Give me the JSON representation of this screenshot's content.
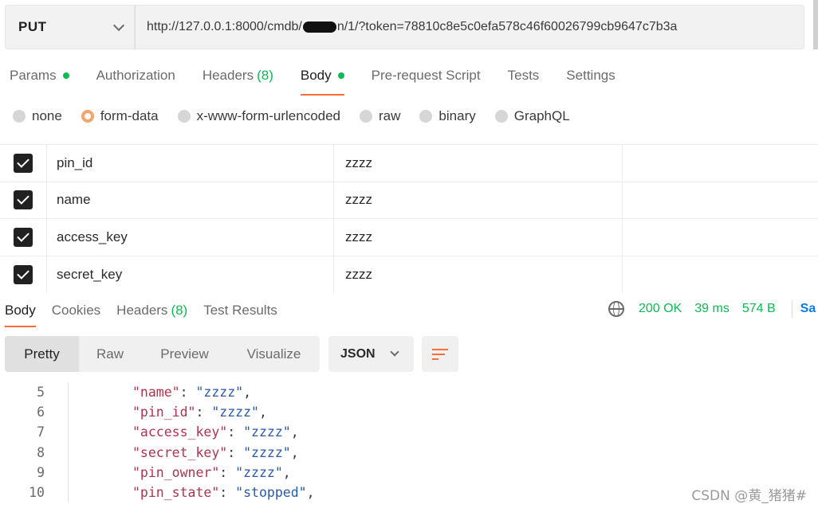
{
  "request": {
    "method": "PUT",
    "url_prefix": "http://127.0.0.1:8000/cmdb/",
    "url_mid": "",
    "url_suffix": "n/1/?token=78810c8e5c0efa578c46f60026799cb9647c7b3a"
  },
  "request_tabs": [
    {
      "label": "Params",
      "dot": true
    },
    {
      "label": "Authorization"
    },
    {
      "label": "Headers",
      "count": "(8)"
    },
    {
      "label": "Body",
      "dot": true,
      "active": true
    },
    {
      "label": "Pre-request Script"
    },
    {
      "label": "Tests"
    },
    {
      "label": "Settings"
    }
  ],
  "body_types": [
    "none",
    "form-data",
    "x-www-form-urlencoded",
    "raw",
    "binary",
    "GraphQL"
  ],
  "body_type_selected": "form-data",
  "form_rows": [
    {
      "key": "pin_id",
      "value": "zzzz"
    },
    {
      "key": "name",
      "value": "zzzz"
    },
    {
      "key": "access_key",
      "value": "zzzz"
    },
    {
      "key": "secret_key",
      "value": "zzzz"
    }
  ],
  "response_tabs": [
    {
      "label": "Body",
      "active": true
    },
    {
      "label": "Cookies"
    },
    {
      "label": "Headers",
      "count": "(8)"
    },
    {
      "label": "Test Results"
    }
  ],
  "response_meta": {
    "status": "200 OK",
    "time": "39 ms",
    "size": "574 B",
    "save_cut": "Sa"
  },
  "view_modes": [
    "Pretty",
    "Raw",
    "Preview",
    "Visualize"
  ],
  "format": "JSON",
  "code_lines": [
    {
      "n": "5",
      "key": "\"name\"",
      "value": "\"zzzz\"",
      "tail": ","
    },
    {
      "n": "6",
      "key": "\"pin_id\"",
      "value": "\"zzzz\"",
      "tail": ","
    },
    {
      "n": "7",
      "key": "\"access_key\"",
      "value": "\"zzzz\"",
      "tail": ","
    },
    {
      "n": "8",
      "key": "\"secret_key\"",
      "value": "\"zzzz\"",
      "tail": ","
    },
    {
      "n": "9",
      "key": "\"pin_owner\"",
      "value": "\"zzzz\"",
      "tail": ","
    },
    {
      "n": "10",
      "key": "\"pin_state\"",
      "value": "\"stopped\"",
      "tail": ","
    }
  ],
  "watermark": "CSDN @黄_猪猪#",
  "colors": {
    "accent": "#ff6c37",
    "success": "#0cbb52",
    "key": "#b5314f",
    "string": "#2b59a8"
  }
}
